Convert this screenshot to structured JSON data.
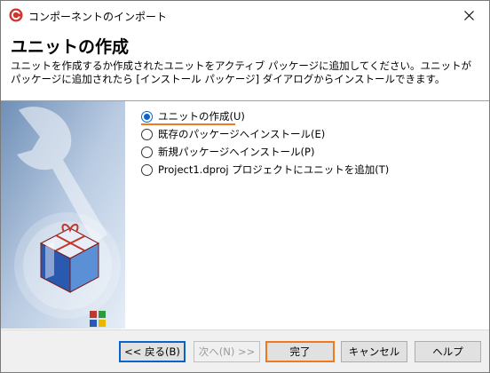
{
  "window": {
    "title": "コンポーネントのインポート"
  },
  "header": {
    "title": "ユニットの作成",
    "description": "ユニットを作成するか作成されたユニットをアクティブ パッケージに追加してください。ユニットがパッケージに追加されたら [インストール パッケージ] ダイアログからインストールできます。"
  },
  "options": [
    {
      "label": "ユニットの作成(U)",
      "selected": true
    },
    {
      "label": "既存のパッケージへインストール(E)",
      "selected": false
    },
    {
      "label": "新規パッケージへインストール(P)",
      "selected": false
    },
    {
      "label": "Project1.dproj プロジェクトにユニットを追加(T)",
      "selected": false
    }
  ],
  "buttons": {
    "back": "<< 戻る(B)",
    "next": "次へ(N) >>",
    "finish": "完了",
    "cancel": "キャンセル",
    "help": "ヘルプ"
  },
  "colors": {
    "accent_blue": "#0a64c8",
    "highlight_orange": "#f07820",
    "footer_bg": "#f0f0f0"
  }
}
